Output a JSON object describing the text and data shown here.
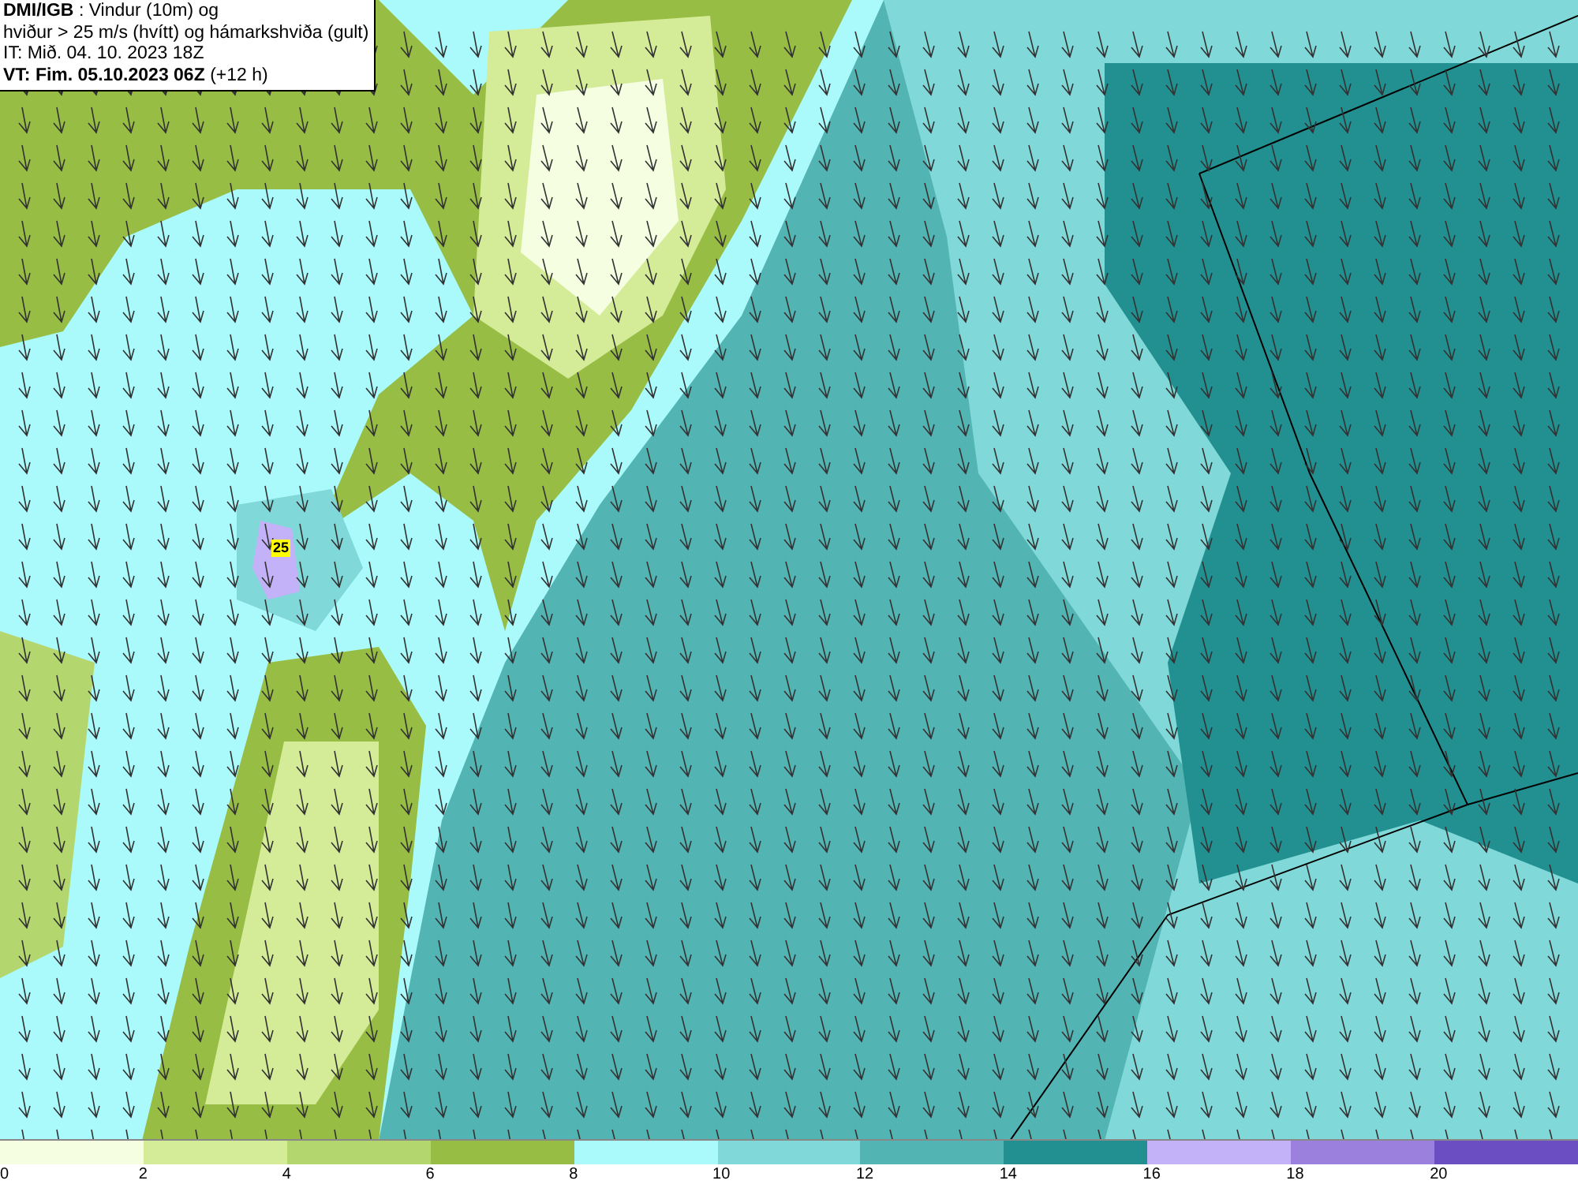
{
  "header": {
    "source": "DMI/IGB",
    "title_line_1": ": Vindur (10m) og",
    "title_line_2": "hviður > 25 m/s (hvítt) og hámarkshviða (gult)",
    "issue_time": "IT: Mið. 04. 10. 2023 18Z",
    "valid_time": "VT: Fim. 05.10.2023 06Z",
    "valid_offset": "(+12 h)"
  },
  "map": {
    "gust_marker": "25"
  },
  "legend": {
    "bins": [
      {
        "color": "#f6fee2"
      },
      {
        "color": "#d4eb98"
      },
      {
        "color": "#b3d76e"
      },
      {
        "color": "#97bd44"
      },
      {
        "color": "#aafafc"
      },
      {
        "color": "#80d8d8"
      },
      {
        "color": "#53b4b4"
      },
      {
        "color": "#229090"
      },
      {
        "color": "#c4b2f8"
      },
      {
        "color": "#9c80de"
      },
      {
        "color": "#6b4fc2"
      }
    ],
    "ticks": [
      "0",
      "2",
      "4",
      "6",
      "8",
      "10",
      "12",
      "14",
      "16",
      "18",
      "20"
    ]
  }
}
